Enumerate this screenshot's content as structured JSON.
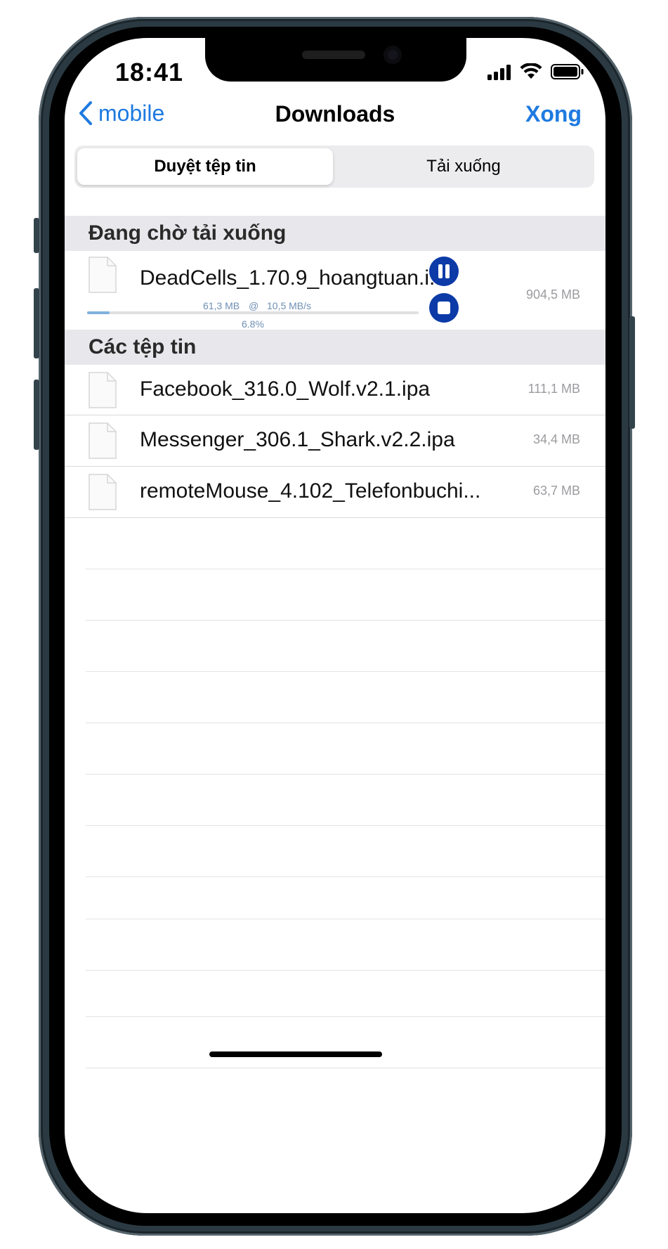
{
  "status_bar": {
    "time": "18:41"
  },
  "nav": {
    "back_label": "mobile",
    "title": "Downloads",
    "done_label": "Xong"
  },
  "segments": {
    "browse_label": "Duyệt tệp tin",
    "downloads_label": "Tải xuống",
    "selected": "Duyệt tệp tin"
  },
  "pending": {
    "header": "Đang chờ tải xuống",
    "item": {
      "name": "DeadCells_1.70.9_hoangtuan.i...",
      "size": "904,5 MB",
      "downloaded": "61,3 MB",
      "at_symbol": "@",
      "speed": "10,5 MB/s",
      "percent": "6.8%",
      "progress_fraction": 0.068
    }
  },
  "files": {
    "header": "Các tệp tin",
    "items": [
      {
        "name": "Facebook_316.0_Wolf.v2.1.ipa",
        "size": "111,1 MB"
      },
      {
        "name": "Messenger_306.1_Shark.v2.2.ipa",
        "size": "34,4 MB"
      },
      {
        "name": "remoteMouse_4.102_Telefonbuchi...",
        "size": "63,7 MB"
      }
    ]
  },
  "colors": {
    "accent": "#1e7ae0",
    "control_blue": "#0c3ba8",
    "progress": "#7fb1de",
    "frame": "#2b3a42"
  },
  "icons": [
    "chevron-left-icon",
    "signal-icon",
    "wifi-icon",
    "battery-icon",
    "document-icon",
    "pause-icon",
    "stop-icon"
  ]
}
